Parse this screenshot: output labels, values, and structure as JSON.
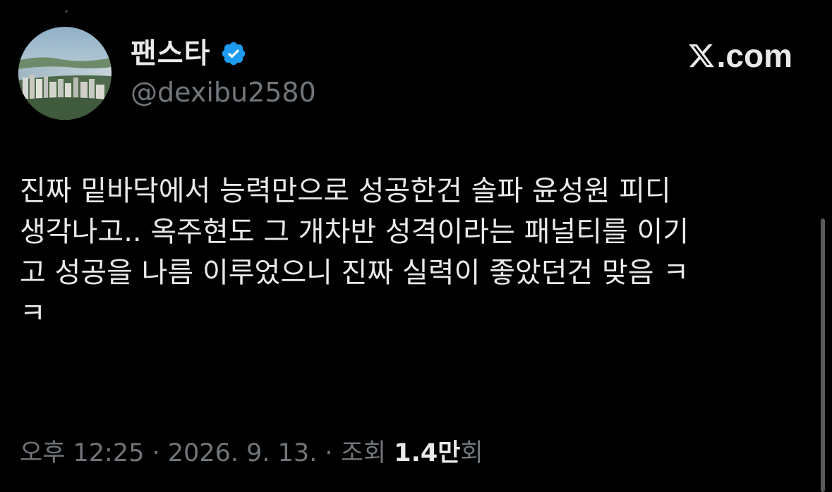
{
  "author": {
    "display_name": "팬스타",
    "handle": "@dexibu2580",
    "verified": true,
    "avatar_icon": "city-river-photo-avatar"
  },
  "brand": {
    "text": ".com",
    "logo_icon": "x-logo-icon"
  },
  "tweet": {
    "text": "진짜 밑바닥에서 능력만으로 성공한건 솔파 윤성원 피디\n생각나고.. 옥주현도 그 개차반 성격이라는 패널티를 이기\n고 성공을 나름 이루었으니 진짜 실력이 좋았던건 맞음 ㅋ\nㅋ"
  },
  "meta": {
    "time": "오후 12:25",
    "separator": " · ",
    "date": "2026. 9. 13.",
    "views_label": "조회",
    "views_count": "1.4",
    "views_unit": "만",
    "views_suffix": "회"
  },
  "colors": {
    "background": "#000000",
    "primary_text": "#e7e9ea",
    "secondary_text": "#71767b",
    "verified_badge": "#1d9bf0"
  }
}
